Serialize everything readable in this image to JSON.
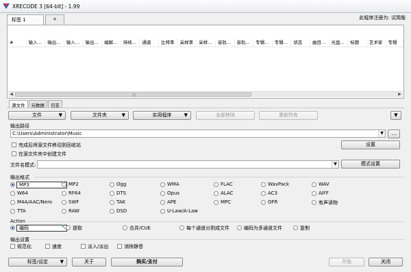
{
  "window": {
    "title": "XRECODE 3 [64-bit] - 1.99",
    "registered": "此程序注册为: 试用版"
  },
  "doc_tabs": [
    "标签 1",
    "+"
  ],
  "columns": [
    "#",
    "输入...",
    "输出...",
    "输入...",
    "输出...",
    "编解...",
    "持续...",
    "通道",
    "比特率",
    "采样率",
    "采样...",
    "音轨...",
    "音轨...",
    "专辑...",
    "专辑...",
    "状态",
    "曲目...",
    "光盘...",
    "标题",
    "艺术家",
    "专辑"
  ],
  "sub_tabs": [
    "源文件",
    "元数据",
    "日志"
  ],
  "toolbar": {
    "file": "文件",
    "folder": "文件夹",
    "utility": "实用程序",
    "remove_all": "全部移除",
    "rescan": "重新所有",
    "more": "▼"
  },
  "output_path": {
    "label": "输出路径",
    "value": "C:\\Users\\Administrator\\Music",
    "browse": "...",
    "move_src": "完成后将源文件移动到回收站",
    "create_in_src": "在源文件夹中创建文件",
    "settings": "设置"
  },
  "filename_pattern": {
    "label": "文件名模式:",
    "value": "",
    "mode_settings": "模式设置"
  },
  "output_format": {
    "label": "输出格式",
    "items": [
      [
        "MP3",
        "MP2",
        "Ogg",
        "WMA",
        "FLAC",
        "WavPack",
        "WAV"
      ],
      [
        "W64",
        "RF64",
        "DTS",
        "Opus",
        "ALAC",
        "AC3",
        "AIFF"
      ],
      [
        "M4A/AAC/Nero",
        "SWF",
        "TAK",
        "APE",
        "MPC",
        "OFR",
        "有声读物"
      ],
      [
        "TTA",
        "RAW",
        "DSD",
        "U-Law/A-Law"
      ]
    ],
    "selected": "MP3"
  },
  "action": {
    "label": "Action",
    "items": [
      "编码",
      "提取",
      "合并/CUE",
      "每个通道分割成文件",
      "编码为多通道文件",
      "复制"
    ],
    "selected": "编码"
  },
  "output_settings": {
    "label": "输出设置",
    "items": [
      "规范化",
      "速度",
      "淡入/淡出",
      "消除静音"
    ]
  },
  "bottom": {
    "tags": "标签/设定",
    "about": "关于",
    "buy": "购买/支付",
    "start": "开始",
    "close": "关闭"
  },
  "colors": {
    "accent": "#1a4a8a",
    "disabled": "#9a9a9a"
  }
}
